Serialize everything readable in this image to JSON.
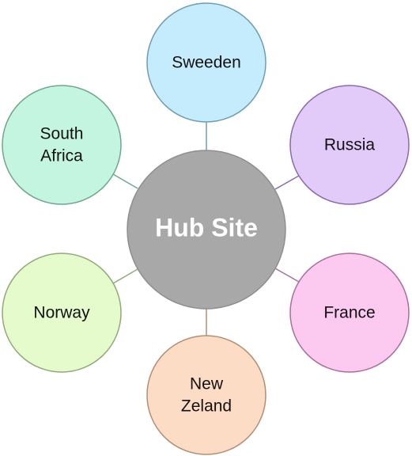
{
  "hub": {
    "label": "Hub Site",
    "fill": "#a8a8a8",
    "stroke": "#8e8e8e"
  },
  "spokes": [
    {
      "id": "sweeden",
      "lines": [
        "Sweeden"
      ],
      "fill": "#c5ecfc",
      "stroke": "#6e9db2"
    },
    {
      "id": "russia",
      "lines": [
        "Russia"
      ],
      "fill": "#e2cbf9",
      "stroke": "#8b6aa8"
    },
    {
      "id": "france",
      "lines": [
        "France"
      ],
      "fill": "#fcc9f1",
      "stroke": "#a86f9b"
    },
    {
      "id": "new-zeland",
      "lines": [
        "New",
        "Zeland"
      ],
      "fill": "#fcdcc4",
      "stroke": "#b08f76"
    },
    {
      "id": "norway",
      "lines": [
        "Norway"
      ],
      "fill": "#e6fbcb",
      "stroke": "#8fa97a"
    },
    {
      "id": "south-africa",
      "lines": [
        "South",
        "Africa"
      ],
      "fill": "#c3f5e0",
      "stroke": "#6ea68e"
    }
  ]
}
